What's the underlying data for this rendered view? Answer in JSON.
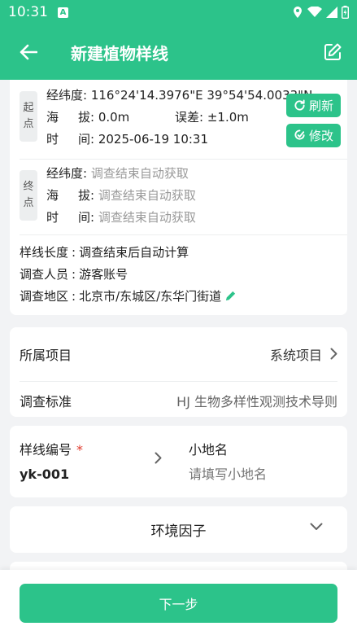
{
  "status": {
    "time": "10:31",
    "note_icon": "A"
  },
  "appbar": {
    "title": "新建植物样线"
  },
  "start": {
    "tag": [
      "起",
      "点"
    ],
    "coord_label": "经纬度",
    "coord_value": "116°24'14.3976\"E 39°54'54.0033\"N",
    "alt_label": "海拔",
    "alt_value": "0.0m",
    "err_label": "误差",
    "err_value": "±1.0m",
    "time_label": "时间",
    "time_value": "2025-06-19 10:31",
    "refresh_label": "刷新",
    "modify_label": "修改"
  },
  "end": {
    "tag": [
      "终",
      "点"
    ],
    "coord_label": "经纬度",
    "coord_value": "调查结束自动获取",
    "alt_label": "海拔",
    "alt_value": "调查结束自动获取",
    "time_label": "时间",
    "time_value": "调查结束自动获取"
  },
  "info": {
    "length_label": "样线长度",
    "length_value": "调查结束后自动计算",
    "person_label": "调查人员",
    "person_value": "游客账号",
    "area_label": "调查地区",
    "area_value": "北京市/东城区/东华门街道"
  },
  "project": {
    "label": "所属项目",
    "value": "系统项目",
    "standard_label": "调查标准",
    "standard_value": "HJ 生物多样性观测技术导则"
  },
  "line": {
    "number_label": "样线编号",
    "required_mark": "*",
    "number_value": "yk-001",
    "place_label": "小地名",
    "place_placeholder": "请填写小地名"
  },
  "env": {
    "label": "环境因子"
  },
  "footer": {
    "next_label": "下一步"
  },
  "colors": {
    "accent": "#2cc38a",
    "required": "#e0392b"
  }
}
